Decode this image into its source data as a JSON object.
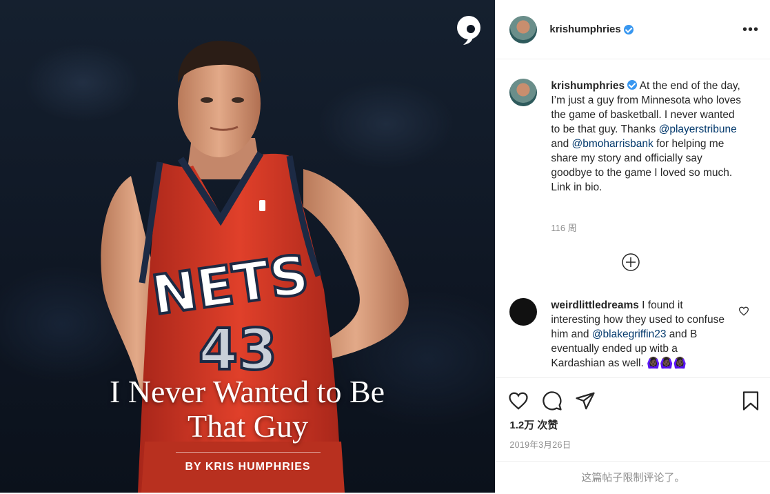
{
  "image": {
    "headline_line1": "I Never Wanted to Be",
    "headline_line2": "That Guy",
    "byline": "BY KRIS HUMPHRIES",
    "jersey_text": "NETS",
    "jersey_number": "43",
    "brand_mark_icon": "quote-icon"
  },
  "header": {
    "username": "krishumphries",
    "verified": true,
    "more_icon": "more-options-icon",
    "more_label": "•••"
  },
  "caption": {
    "username": "krishumphries",
    "text_1": " At the end of the day, I’m just a guy from Minnesota who loves the game of basketball. I never wanted to be that guy. Thanks ",
    "mention_1": "@playerstribune",
    "text_2": " and ",
    "mention_2": "@bmoharrisbank",
    "text_3": " for helping me share my story and officially say goodbye to the game I loved so much. Link in bio.",
    "time": "116 周"
  },
  "load_more_icon": "plus-circle-icon",
  "comment": {
    "username": "weirdlittledreams",
    "text_1": " I found it interesting how they used to confuse him and ",
    "mention": "@blakegriffin23",
    "text_2": " and B eventually ended up witb a Kardashian as well. ",
    "emoji": "🙆🏿‍♀️🙆🏿‍♀️🙆🏿‍♀️",
    "like_icon": "heart-outline-icon"
  },
  "actions": {
    "like_icon": "heart-icon",
    "comment_icon": "comment-icon",
    "share_icon": "paper-plane-icon",
    "save_icon": "bookmark-icon",
    "likes": "1.2万 次赞",
    "date": "2019年3月26日",
    "comments_limited": "这篇帖子限制评论了。"
  },
  "colors": {
    "jersey_red": "#d9321f",
    "jersey_trim": "#1c2a44",
    "mention_blue": "#00376b",
    "verified_blue": "#3897f0"
  }
}
